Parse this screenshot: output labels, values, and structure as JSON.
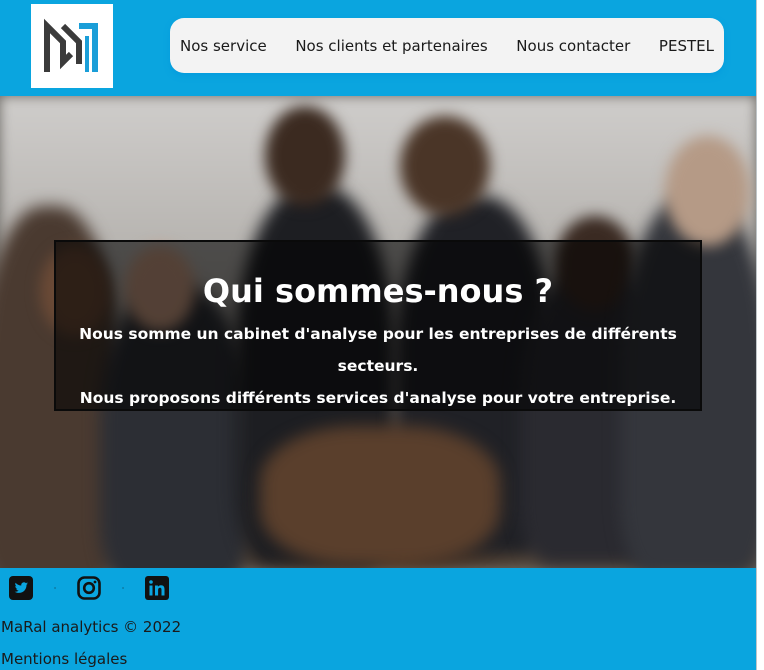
{
  "header": {
    "logo_alt": "MaRal analytics logo",
    "nav": [
      {
        "label": "Nos service"
      },
      {
        "label": "Nos clients et partenaires"
      },
      {
        "label": "Nous contacter"
      },
      {
        "label": "PESTEL"
      }
    ]
  },
  "hero": {
    "title": "Qui sommes-nous ?",
    "line1": "Nous somme un cabinet d'analyse pour les entreprises de différents secteurs.",
    "line2": "Nous proposons différents services d'analyse pour votre entreprise."
  },
  "footer": {
    "social": [
      {
        "icon": "twitter-icon"
      },
      {
        "icon": "instagram-icon"
      },
      {
        "icon": "linkedin-icon"
      }
    ],
    "separator": "·",
    "copyright": "MaRal analytics © 2022",
    "legal": "Mentions légales"
  },
  "colors": {
    "brand_blue": "#0aa5df",
    "nav_bg": "#f3f3f3",
    "overlay_bg": "rgba(0,0,0,0.58)"
  }
}
